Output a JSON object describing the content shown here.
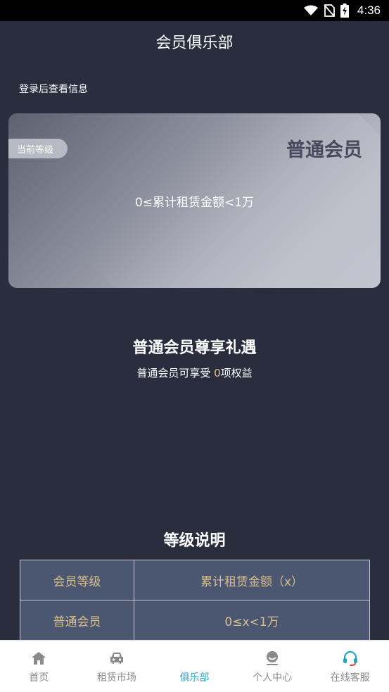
{
  "status_bar": {
    "time": "4:36"
  },
  "header": {
    "title": "会员俱乐部"
  },
  "login_hint": "登录后查看信息",
  "level_card": {
    "badge": "当前等级",
    "level_name": "普通会员",
    "range": "0≤累计租赁金额<1万"
  },
  "benefits": {
    "title": "普通会员尊享礼遇",
    "sub_prefix": "普通会员可享受 ",
    "count": "0",
    "sub_suffix": "项权益"
  },
  "rules": {
    "title": "等级说明",
    "headers": [
      "会员等级",
      "累计租赁金额（x）"
    ],
    "rows": [
      [
        "普通会员",
        "0≤x<1万"
      ]
    ]
  },
  "tabbar": {
    "items": [
      {
        "label": "首页",
        "icon": "home-icon"
      },
      {
        "label": "租赁市场",
        "icon": "car-icon"
      },
      {
        "label": "俱乐部",
        "icon": "club-icon"
      },
      {
        "label": "个人中心",
        "icon": "user-icon"
      },
      {
        "label": "在线客服",
        "icon": "headset-icon"
      }
    ],
    "active_index": 2,
    "active_color": "#2aa3c8"
  }
}
